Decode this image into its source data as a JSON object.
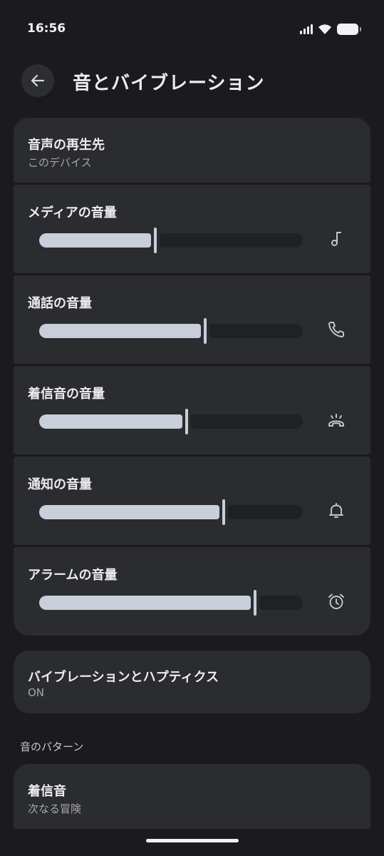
{
  "status_bar": {
    "time": "16:56"
  },
  "header": {
    "title": "音とバイブレーション"
  },
  "audio_output": {
    "title": "音声の再生先",
    "value": "このデバイス"
  },
  "volume_rows": [
    {
      "label": "メディアの音量",
      "level": 0.44,
      "icon": "music-note-icon"
    },
    {
      "label": "通話の音量",
      "level": 0.63,
      "icon": "phone-icon"
    },
    {
      "label": "着信音の音量",
      "level": 0.56,
      "icon": "ring-icon"
    },
    {
      "label": "通知の音量",
      "level": 0.7,
      "icon": "bell-icon"
    },
    {
      "label": "アラームの音量",
      "level": 0.82,
      "icon": "alarm-clock-icon"
    }
  ],
  "vibration": {
    "title": "バイブレーションとハプティクス",
    "value": "ON"
  },
  "sound_pattern": {
    "section_label": "音のパターン",
    "ringtone": {
      "title": "着信音",
      "value": "次なる冒険"
    }
  },
  "colors": {
    "background": "#1b1b1d",
    "card": "#2b2c30",
    "slider_active": "#c9cedb",
    "slider_inactive": "#202124"
  }
}
